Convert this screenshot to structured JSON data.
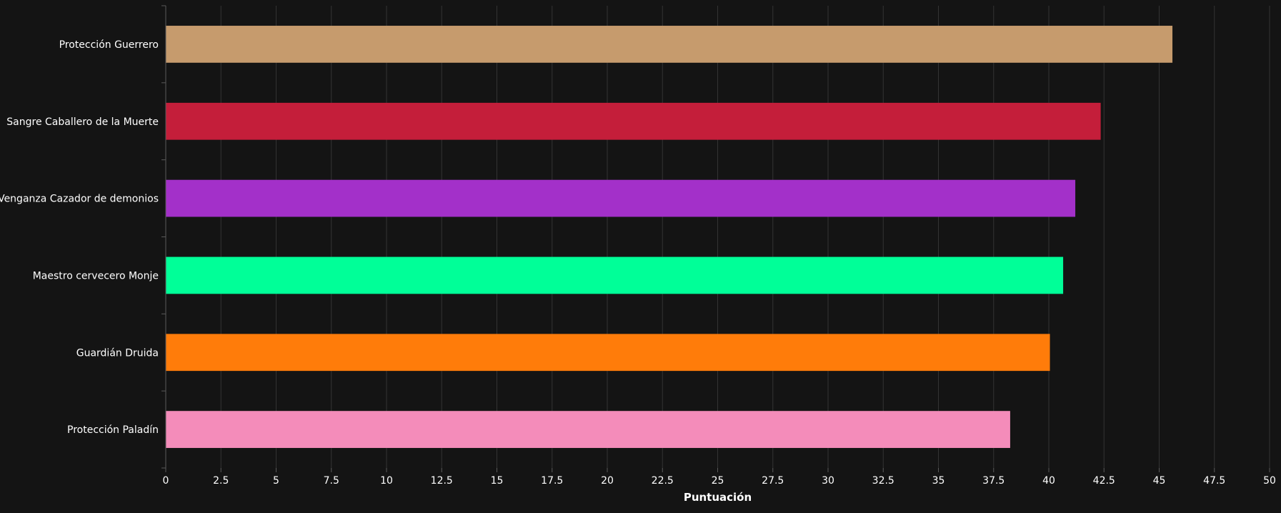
{
  "chart_data": {
    "type": "bar",
    "orientation": "horizontal",
    "categories": [
      "Protección Guerrero",
      "Sangre Caballero de la Muerte",
      "Venganza Cazador de demonios",
      "Maestro cervecero Monje",
      "Guardián Druida",
      "Protección Paladín"
    ],
    "values": [
      45.6,
      42.35,
      41.2,
      40.65,
      40.05,
      38.25
    ],
    "colors": [
      "#c69b6d",
      "#c41e3a",
      "#a330c9",
      "#00ff98",
      "#ff7c0a",
      "#f48cba"
    ],
    "xlabel": "Puntuación",
    "ylabel": "",
    "xlim": [
      0,
      50
    ],
    "xticks": [
      0,
      2.5,
      5,
      7.5,
      10,
      12.5,
      15,
      17.5,
      20,
      22.5,
      25,
      27.5,
      30,
      32.5,
      35,
      37.5,
      40,
      42.5,
      45,
      47.5,
      50
    ],
    "xtick_labels": [
      "0",
      "2.5",
      "5",
      "7.5",
      "10",
      "12.5",
      "15",
      "17.5",
      "20",
      "22.5",
      "25",
      "27.5",
      "30",
      "32.5",
      "35",
      "37.5",
      "40",
      "42.5",
      "45",
      "47.5",
      "50"
    ],
    "grid": true,
    "background": "#141414",
    "grid_color": "#333333",
    "text_color": "#ffffff"
  }
}
